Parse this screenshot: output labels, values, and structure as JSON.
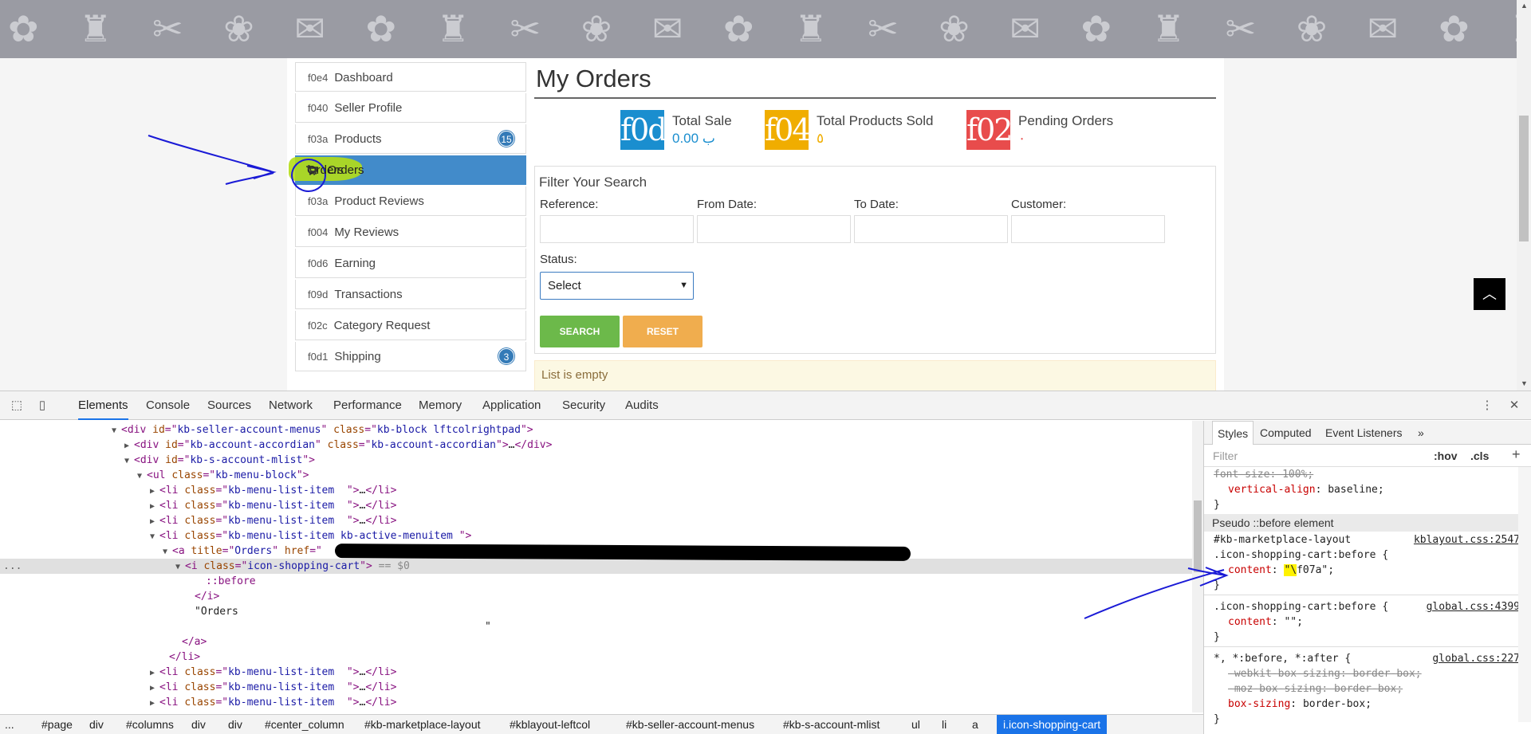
{
  "menu": {
    "items": [
      {
        "icon": "f0e4",
        "label": "Dashboard"
      },
      {
        "icon": "f040",
        "label": "Seller Profile"
      },
      {
        "icon": "f03a",
        "label": "Products",
        "badge": "15"
      },
      {
        "icon": "cart-icon",
        "label": "Orders"
      },
      {
        "icon": "f03a",
        "label": "Product Reviews"
      },
      {
        "icon": "f004",
        "label": "My Reviews"
      },
      {
        "icon": "f0d6",
        "label": "Earning"
      },
      {
        "icon": "f09d",
        "label": "Transactions"
      },
      {
        "icon": "f02c",
        "label": "Category Request"
      },
      {
        "icon": "f0d1",
        "label": "Shipping",
        "badge": "3"
      }
    ]
  },
  "main": {
    "title": "My Orders",
    "stats": [
      {
        "icon_text": "f0d",
        "label": "Total Sale",
        "value": "ب 0.00",
        "color": "#1a8ecf",
        "value_color": "#1a8ecf"
      },
      {
        "icon_text": "f04",
        "label": "Total Products Sold",
        "value": "٥",
        "color": "#f0ad00",
        "value_color": "#f0ad00"
      },
      {
        "icon_text": "f02",
        "label": "Pending Orders",
        "value": "٠",
        "color": "#e84c4c",
        "value_color": "#e84c4c"
      }
    ],
    "filter": {
      "heading": "Filter Your Search",
      "reference_label": "Reference:",
      "from_date_label": "From Date:",
      "to_date_label": "To Date:",
      "customer_label": "Customer:",
      "status_label": "Status:",
      "status_value": "Select",
      "search_button": "SEARCH",
      "reset_button": "RESET"
    },
    "empty_message": "List is empty"
  },
  "devtools": {
    "tabs": [
      "Elements",
      "Console",
      "Sources",
      "Network",
      "Performance",
      "Memory",
      "Application",
      "Security",
      "Audits"
    ],
    "dom_lines": [
      {
        "indent": 152,
        "tri": "▼",
        "parts": [
          [
            "tg",
            "<div "
          ],
          [
            "at",
            "id"
          ],
          [
            "tg",
            "=\""
          ],
          [
            "av",
            "kb-seller-account-menus"
          ],
          [
            "tg",
            "\" "
          ],
          [
            "at",
            "class"
          ],
          [
            "tg",
            "=\""
          ],
          [
            "av",
            "kb-block lftcolrightpad"
          ],
          [
            "tg",
            "\">"
          ]
        ]
      },
      {
        "indent": 168,
        "tri": "▶",
        "parts": [
          [
            "tg",
            "<div "
          ],
          [
            "at",
            "id"
          ],
          [
            "tg",
            "=\""
          ],
          [
            "av",
            "kb-account-accordian"
          ],
          [
            "tg",
            "\" "
          ],
          [
            "at",
            "class"
          ],
          [
            "tg",
            "=\""
          ],
          [
            "av",
            "kb-account-accordian"
          ],
          [
            "tg",
            "\">"
          ],
          [
            "tx",
            "…"
          ],
          [
            "tg",
            "</div>"
          ]
        ]
      },
      {
        "indent": 168,
        "tri": "▼",
        "parts": [
          [
            "tg",
            "<div "
          ],
          [
            "at",
            "id"
          ],
          [
            "tg",
            "=\""
          ],
          [
            "av",
            "kb-s-account-mlist"
          ],
          [
            "tg",
            "\">"
          ]
        ]
      },
      {
        "indent": 184,
        "tri": "▼",
        "parts": [
          [
            "tg",
            "<ul "
          ],
          [
            "at",
            "class"
          ],
          [
            "tg",
            "=\""
          ],
          [
            "av",
            "kb-menu-block"
          ],
          [
            "tg",
            "\">"
          ]
        ]
      },
      {
        "indent": 200,
        "tri": "▶",
        "parts": [
          [
            "tg",
            "<li "
          ],
          [
            "at",
            "class"
          ],
          [
            "tg",
            "=\""
          ],
          [
            "av",
            "kb-menu-list-item  "
          ],
          [
            "tg",
            "\">"
          ],
          [
            "tx",
            "…"
          ],
          [
            "tg",
            "</li>"
          ]
        ]
      },
      {
        "indent": 200,
        "tri": "▶",
        "parts": [
          [
            "tg",
            "<li "
          ],
          [
            "at",
            "class"
          ],
          [
            "tg",
            "=\""
          ],
          [
            "av",
            "kb-menu-list-item  "
          ],
          [
            "tg",
            "\">"
          ],
          [
            "tx",
            "…"
          ],
          [
            "tg",
            "</li>"
          ]
        ]
      },
      {
        "indent": 200,
        "tri": "▶",
        "parts": [
          [
            "tg",
            "<li "
          ],
          [
            "at",
            "class"
          ],
          [
            "tg",
            "=\""
          ],
          [
            "av",
            "kb-menu-list-item  "
          ],
          [
            "tg",
            "\">"
          ],
          [
            "tx",
            "…"
          ],
          [
            "tg",
            "</li>"
          ]
        ]
      },
      {
        "indent": 200,
        "tri": "▼",
        "parts": [
          [
            "tg",
            "<li "
          ],
          [
            "at",
            "class"
          ],
          [
            "tg",
            "=\""
          ],
          [
            "av",
            "kb-menu-list-item kb-active-menuitem "
          ],
          [
            "tg",
            "\">"
          ]
        ]
      },
      {
        "indent": 216,
        "tri": "▼",
        "parts": [
          [
            "tg",
            "<a "
          ],
          [
            "at",
            "title"
          ],
          [
            "tg",
            "=\""
          ],
          [
            "av",
            "Orders"
          ],
          [
            "tg",
            "\" "
          ],
          [
            "at",
            "href"
          ],
          [
            "tg",
            "=\""
          ]
        ]
      },
      {
        "indent": 232,
        "tri": "▼",
        "sel": true,
        "parts": [
          [
            "tg",
            "<i "
          ],
          [
            "at",
            "class"
          ],
          [
            "tg",
            "=\""
          ],
          [
            "av",
            "icon-shopping-cart"
          ],
          [
            "tg",
            "\">"
          ],
          [
            "gray",
            " == $0"
          ]
        ]
      },
      {
        "indent": 258,
        "tri": "",
        "parts": [
          [
            "tg",
            "::before"
          ]
        ]
      },
      {
        "indent": 244,
        "tri": "",
        "parts": [
          [
            "tg",
            "</i>"
          ]
        ]
      },
      {
        "indent": 244,
        "tri": "",
        "parts": [
          [
            "tx",
            "\"Orders"
          ]
        ]
      },
      {
        "indent": 608,
        "tri": "",
        "parts": [
          [
            "tx",
            "\""
          ]
        ]
      },
      {
        "indent": 228,
        "tri": "",
        "parts": [
          [
            "tg",
            "</a>"
          ]
        ]
      },
      {
        "indent": 212,
        "tri": "",
        "parts": [
          [
            "tg",
            "</li>"
          ]
        ]
      },
      {
        "indent": 200,
        "tri": "▶",
        "parts": [
          [
            "tg",
            "<li "
          ],
          [
            "at",
            "class"
          ],
          [
            "tg",
            "=\""
          ],
          [
            "av",
            "kb-menu-list-item  "
          ],
          [
            "tg",
            "\">"
          ],
          [
            "tx",
            "…"
          ],
          [
            "tg",
            "</li>"
          ]
        ]
      },
      {
        "indent": 200,
        "tri": "▶",
        "parts": [
          [
            "tg",
            "<li "
          ],
          [
            "at",
            "class"
          ],
          [
            "tg",
            "=\""
          ],
          [
            "av",
            "kb-menu-list-item  "
          ],
          [
            "tg",
            "\">"
          ],
          [
            "tx",
            "…"
          ],
          [
            "tg",
            "</li>"
          ]
        ]
      },
      {
        "indent": 200,
        "tri": "▶",
        "parts": [
          [
            "tg",
            "<li "
          ],
          [
            "at",
            "class"
          ],
          [
            "tg",
            "=\""
          ],
          [
            "av",
            "kb-menu-list-item  "
          ],
          [
            "tg",
            "\">"
          ],
          [
            "tx",
            "…"
          ],
          [
            "tg",
            "</li>"
          ]
        ]
      }
    ],
    "side_tabs": [
      "Styles",
      "Computed",
      "Event Listeners",
      "»"
    ],
    "filter_placeholder": "Filter",
    "hov": ":hov",
    "cls": ".cls",
    "styles": {
      "top_prop1": "font-size: 100%;",
      "top_prop2_name": "vertical-align",
      "top_prop2_value": "baseline;",
      "pseudo_heading": "Pseudo ::before element",
      "rule1_selector_a": "#kb-marketplace-layout",
      "rule1_selector_b": ".icon-shopping-cart:before {",
      "rule1_file": "kblayout.css:2547",
      "rule1_prop": "content",
      "rule1_value_hl": "\"\\",
      "rule1_value_rest": "f07a\";",
      "rule2_selector": ".icon-shopping-cart:before {",
      "rule2_file": "global.css:4399",
      "rule2_prop": "content",
      "rule2_value": "\"\";",
      "rule3_selector": "*, *:before, *:after {",
      "rule3_file": "global.css:227",
      "rule3_p1": "-webkit-box-sizing: border-box;",
      "rule3_p2": "-moz-box-sizing: border-box;",
      "rule3_p3_name": "box-sizing",
      "rule3_p3_value": "border-box;",
      "close": "}"
    },
    "breadcrumbs": [
      "...",
      "#page",
      "div",
      "#columns",
      "div",
      "div",
      "#center_column",
      "#kb-marketplace-layout",
      "#kblayout-leftcol",
      "#kb-seller-account-menus",
      "#kb-s-account-mlist",
      "ul",
      "li",
      "a",
      "i.icon-shopping-cart"
    ]
  }
}
